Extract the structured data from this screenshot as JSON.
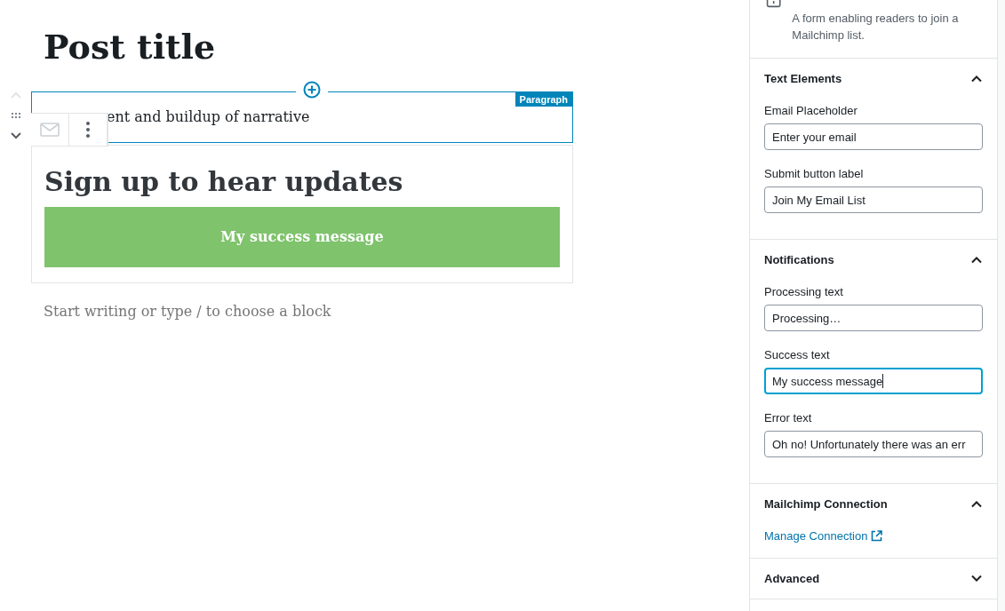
{
  "editor": {
    "post_title": "Post title",
    "paragraph": {
      "visible_text": "ent and buildup of narrative",
      "tag": "Paragraph",
      "selected": true
    },
    "form_block": {
      "heading": "Sign up to hear updates",
      "success_message": "My success message"
    },
    "placeholder": "Start writing or type / to choose a block"
  },
  "sidebar": {
    "block": {
      "description": "A form enabling readers to join a Mailchimp list."
    },
    "panels": [
      {
        "title": "Text Elements",
        "expanded": true,
        "fields": [
          {
            "label": "Email Placeholder",
            "value": "Enter your email",
            "focused": false
          },
          {
            "label": "Submit button label",
            "value": "Join My Email List",
            "focused": false
          }
        ]
      },
      {
        "title": "Notifications",
        "expanded": true,
        "fields": [
          {
            "label": "Processing text",
            "value": "Processing…",
            "focused": false
          },
          {
            "label": "Success text",
            "value": "My success message",
            "focused": true
          },
          {
            "label": "Error text",
            "value": "Oh no! Unfortunately there was an err",
            "focused": false
          }
        ]
      },
      {
        "title": "Mailchimp Connection",
        "expanded": true,
        "link": "Manage Connection"
      },
      {
        "title": "Advanced",
        "expanded": false
      }
    ]
  }
}
